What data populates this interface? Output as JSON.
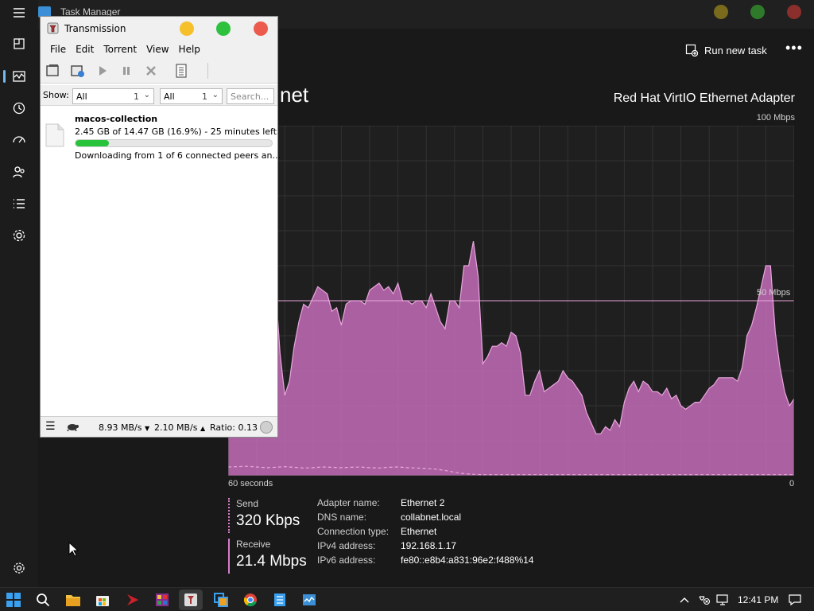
{
  "task_manager": {
    "window_title": "Task Manager",
    "run_new_task": "Run new task",
    "more": "•••",
    "page_heading": "net",
    "adapter_name": "Red Hat VirtIO Ethernet Adapter",
    "max_label": "100 Mbps",
    "mid_label": "50 Mbps",
    "x_left_label": "60 seconds",
    "x_right_label": "0",
    "send_label": "Send",
    "send_value": "320 Kbps",
    "receive_label": "Receive",
    "receive_value": "21.4 Mbps",
    "details": [
      {
        "key": "Adapter name:",
        "value": "Ethernet 2"
      },
      {
        "key": "DNS name:",
        "value": "collabnet.local"
      },
      {
        "key": "Connection type:",
        "value": "Ethernet"
      },
      {
        "key": "IPv4 address:",
        "value": "192.168.1.17"
      },
      {
        "key": "IPv6 address:",
        "value": "fe80::e8b4:a831:96e2:f488%14"
      }
    ],
    "sidebar_icons": [
      "hamburger-icon",
      "processes-icon",
      "performance-icon",
      "app-history-icon",
      "startup-icon",
      "users-icon",
      "details-icon",
      "services-icon",
      "settings-icon"
    ],
    "colors": {
      "accent": "#76b9ed",
      "chart": "#d77ec8",
      "background": "#1c1c1c"
    }
  },
  "chart_data": {
    "type": "area",
    "ymax_mbps": 100,
    "grid": true,
    "receive_series": [
      10,
      62,
      63,
      48,
      59,
      58,
      55,
      65,
      60,
      45,
      55,
      35,
      23,
      27,
      37,
      44,
      49,
      48,
      51,
      54,
      53,
      52,
      47,
      48,
      43,
      49,
      50,
      50,
      50,
      49,
      53,
      54,
      55,
      53,
      54,
      52,
      55,
      50,
      50,
      49,
      50,
      50,
      48,
      52,
      48,
      44,
      42,
      50,
      50,
      48,
      60,
      60,
      67,
      57,
      32,
      34,
      37,
      37,
      38,
      37,
      41,
      40,
      35,
      23,
      23,
      27,
      30,
      24,
      25,
      26,
      27,
      30,
      28,
      27,
      25,
      23,
      18,
      15,
      12,
      12,
      14,
      13,
      16,
      14,
      21,
      25,
      27,
      24,
      27,
      26,
      24,
      24,
      23,
      25,
      22,
      23,
      20,
      19,
      20,
      21,
      21,
      23,
      25,
      26,
      28,
      28,
      28,
      28,
      27,
      31,
      40,
      43,
      48,
      54,
      60,
      60,
      41,
      31,
      24,
      20,
      22
    ],
    "send_series": [
      2.5,
      2.6,
      2.7,
      2.5,
      2.3,
      2.4,
      2.6,
      2.4,
      2.2,
      2.3,
      2.5,
      2.4,
      2.3,
      2.4,
      2.5,
      2.3,
      2.2,
      2.4,
      2.5,
      2.3,
      2.2,
      2.1,
      1.9,
      1.5,
      1.0,
      0.6,
      0.4,
      0.3,
      0.3,
      0.3,
      0.3,
      0.3,
      0.3,
      0.3,
      0.3,
      0.3,
      0.3,
      0.3,
      0.3,
      0.3,
      0.3,
      0.3,
      0.3,
      0.3,
      0.3,
      0.3,
      0.3,
      0.3,
      0.3,
      0.3,
      0.3,
      0.3,
      0.3,
      0.3,
      0.3,
      0.3,
      0.3,
      0.3,
      0.3,
      0.3,
      0.3
    ]
  },
  "transmission": {
    "title": "Transmission",
    "menu": [
      {
        "label": "File"
      },
      {
        "label": "Edit"
      },
      {
        "label": "Torrent"
      },
      {
        "label": "View"
      },
      {
        "label": "Help"
      }
    ],
    "show_label": "Show:",
    "filter1": {
      "value": "All",
      "count": "1"
    },
    "filter2": {
      "value": "All",
      "count": "1"
    },
    "search_placeholder": "Search...",
    "torrent": {
      "name": "macos-collection",
      "progress_text": "2.45 GB of 14.47 GB (16.9%) - 25 minutes left",
      "progress": 0.169,
      "status": "Downloading from 1 of 6 connected peers an..."
    },
    "status_bar": {
      "down": "8.93 MB/s",
      "up": "2.10 MB/s",
      "ratio": "Ratio: 0.13"
    },
    "dot_colors": [
      "#f5c02a",
      "#2ec13e",
      "#ec5a4d"
    ]
  },
  "taskbar": {
    "clock": "12:41 PM",
    "apps": [
      "start-icon",
      "search-icon",
      "file-explorer-icon",
      "store-icon",
      "red-app-icon",
      "colorful-app-icon",
      "transmission-icon",
      "copy-app-icon",
      "chrome-icon",
      "notepad-icon",
      "task-manager-icon"
    ]
  }
}
